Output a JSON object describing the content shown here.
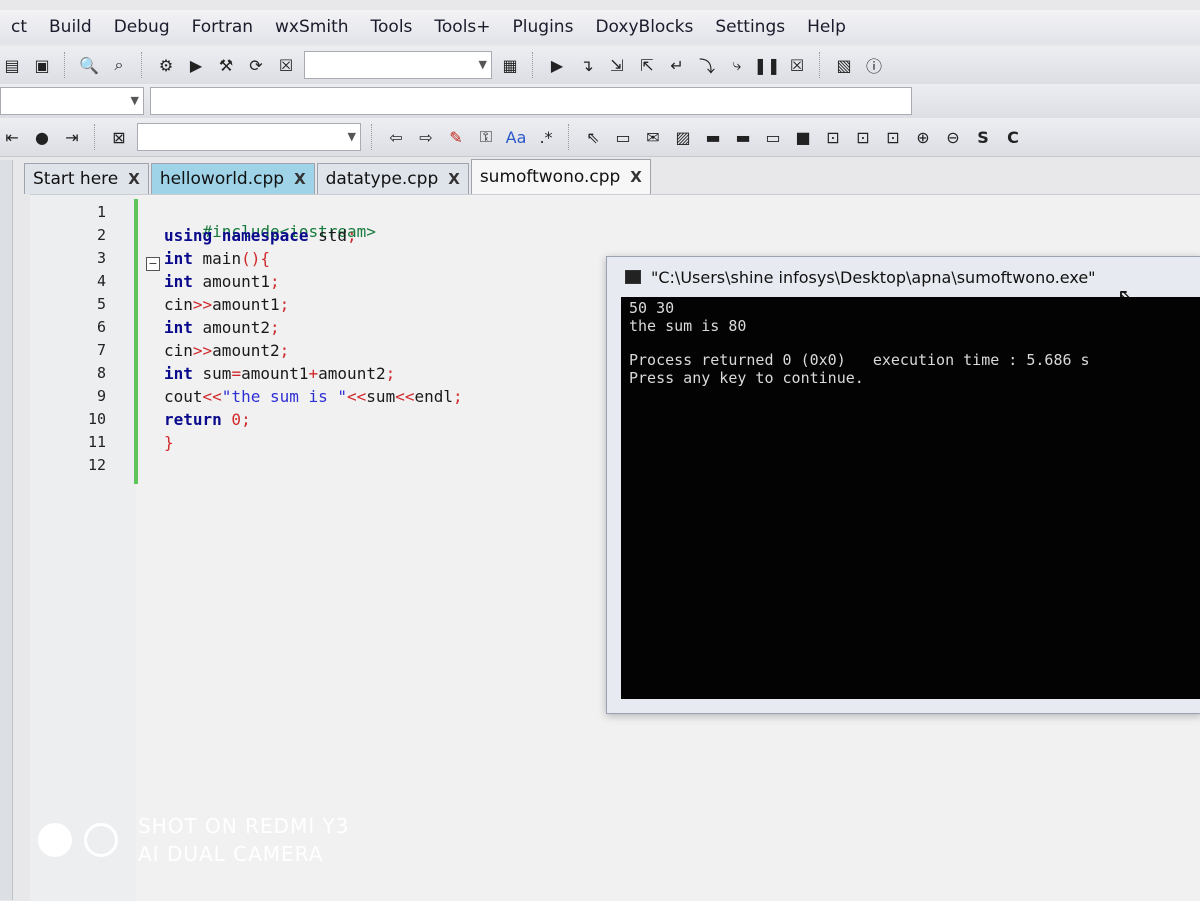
{
  "menubar": {
    "items": [
      "ct",
      "Build",
      "Debug",
      "Fortran",
      "wxSmith",
      "Tools",
      "Tools+",
      "Plugins",
      "DoxyBlocks",
      "Settings",
      "Help"
    ]
  },
  "toolbar_icons": {
    "row1": [
      "file-icon",
      "open-icon",
      "search-icon",
      "find-replace-icon",
      "gear-icon",
      "run-icon",
      "build-run-icon",
      "rebuild-icon",
      "stop-icon"
    ],
    "row2": [
      "debug-run-icon",
      "next-line-icon",
      "step-into-icon",
      "step-out-icon",
      "next-instruction-icon",
      "pause-icon",
      "stop-debug-icon",
      "debug-window-icon",
      "info-icon"
    ],
    "row3": [
      "prev-bookmark-icon",
      "toggle-bookmark-icon",
      "next-bookmark-icon",
      "clear-icon",
      "back-icon",
      "forward-icon",
      "highlight-icon",
      "replace-icon",
      "match-case-icon",
      "regex-icon",
      "select-icon"
    ]
  },
  "tabs": [
    {
      "label": "Start here",
      "close": "X"
    },
    {
      "label": "helloworld.cpp",
      "close": "X"
    },
    {
      "label": "datatype.cpp",
      "close": "X"
    },
    {
      "label": "sumoftwono.cpp",
      "close": "X"
    }
  ],
  "editor": {
    "line_numbers": [
      "1",
      "2",
      "3",
      "4",
      "5",
      "6",
      "7",
      "8",
      "9",
      "10",
      "11",
      "12"
    ],
    "fold_marker": "−",
    "lines": [
      {
        "a": "#include<iostream>"
      },
      {
        "a": "using namespace",
        "b": " std",
        "c": ";"
      },
      {
        "a": "int",
        "b": " main",
        "c": "(){"
      },
      {
        "a": "int",
        "b": " amount1",
        "c": ";"
      },
      {
        "a": "cin",
        "b": ">>",
        "c": "amount1",
        "d": ";"
      },
      {
        "a": "int",
        "b": " amount2",
        "c": ";"
      },
      {
        "a": "cin",
        "b": ">>",
        "c": "amount2",
        "d": ";"
      },
      {
        "a": "int",
        "b": " sum",
        "c": "=",
        "d": "amount1",
        "e": "+",
        "f": "amount2",
        "g": ";"
      },
      {
        "a": "cout",
        "b": "<<",
        "c": "\"the sum is \"",
        "d": "<<",
        "e": "sum",
        "f": "<<",
        "g": "endl",
        "h": ";"
      },
      {
        "a": "return",
        "b": " 0",
        "c": ";"
      },
      {
        "a": "}"
      }
    ]
  },
  "console": {
    "title": "\"C:\\Users\\shine infosys\\Desktop\\apna\\sumoftwono.exe\"",
    "lines": [
      "50 30",
      "the sum is 80",
      "",
      "Process returned 0 (0x0)   execution time : 5.686 s",
      "Press any key to continue."
    ]
  },
  "watermark": {
    "line1": "SHOT ON REDMI Y3",
    "line2": "AI DUAL CAMERA"
  }
}
